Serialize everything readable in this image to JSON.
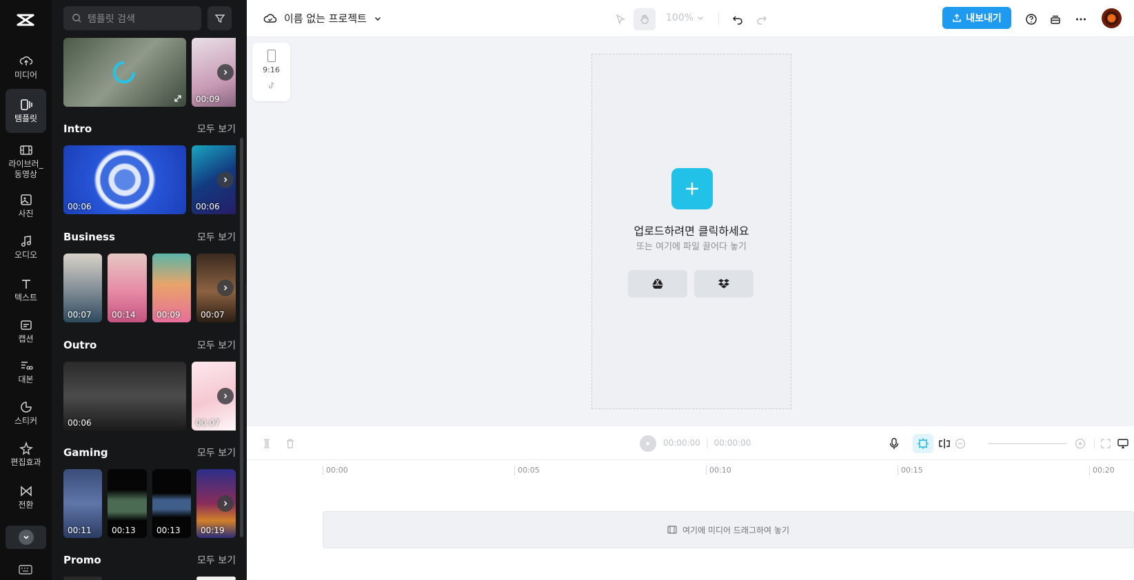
{
  "rail": {
    "items": [
      {
        "label": "미디어",
        "icon": "cloud-upload-icon"
      },
      {
        "label": "템플릿",
        "icon": "template-icon"
      },
      {
        "label": "라이브러_\n동영상",
        "icon": "film-icon"
      },
      {
        "label": "사진",
        "icon": "image-icon"
      },
      {
        "label": "오디오",
        "icon": "music-icon"
      },
      {
        "label": "텍스트",
        "icon": "text-icon"
      },
      {
        "label": "캡션",
        "icon": "caption-icon"
      },
      {
        "label": "대본",
        "icon": "script-icon"
      },
      {
        "label": "스티커",
        "icon": "sticker-icon"
      },
      {
        "label": "편집효과",
        "icon": "effects-icon"
      },
      {
        "label": "전환",
        "icon": "transition-icon"
      }
    ]
  },
  "panel": {
    "search_placeholder": "템플릿 검색",
    "top_row": {
      "durations": [
        "",
        "00:09"
      ]
    },
    "sections": [
      {
        "title": "Intro",
        "see_all": "모두 보기",
        "durations": [
          "00:06",
          "00:06"
        ]
      },
      {
        "title": "Business",
        "see_all": "모두 보기",
        "durations": [
          "00:07",
          "00:14",
          "00:09",
          "00:07"
        ]
      },
      {
        "title": "Outro",
        "see_all": "모두 보기",
        "durations": [
          "00:06",
          "00:07"
        ]
      },
      {
        "title": "Gaming",
        "see_all": "모두 보기",
        "durations": [
          "00:11",
          "00:13",
          "00:13",
          "00:19"
        ]
      },
      {
        "title": "Promo",
        "see_all": "모두 보기",
        "durations": []
      }
    ]
  },
  "topbar": {
    "project_name": "이름 없는 프로젝트",
    "zoom": "100%",
    "export_label": "내보내기"
  },
  "canvas": {
    "ratio": "9:16",
    "upload_title": "업로드하려면 클릭하세요",
    "upload_sub": "또는 여기에 파일 끌어다 놓기"
  },
  "timeline": {
    "current_time": "00:00:00",
    "total_time": "00:00:00",
    "ticks": [
      "00:00",
      "00:05",
      "00:10",
      "00:15",
      "00:20"
    ],
    "drop_hint": "여기에 미디어 드래그하여 놓기"
  },
  "colors": {
    "accent": "#22c2e8",
    "export": "#1e9bf0",
    "rail_bg": "#0f0f10",
    "panel_bg": "#161718"
  }
}
